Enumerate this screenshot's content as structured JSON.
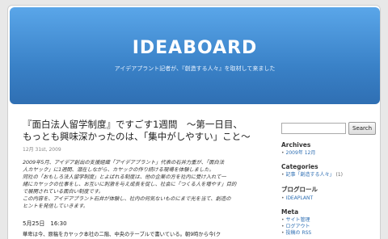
{
  "header": {
    "title": "IDEABOARD",
    "description": "アイデアプラント記者が、『創造する人々』を取材して来ました"
  },
  "post": {
    "title_line1": "『面白法人留学制度』ですごす1週間　～第一日目、",
    "title_line2": "もっとも興味深かったのは、「集中がしやすい」こと～",
    "date": "12月 31st, 2009",
    "intro_lines": [
      "2009年5月、アイデア創出の支援組織「アイデアプラント」代表の石井力重が、「面白法",
      "人カヤック」に1週間、潜在しながら、カヤックの作り続ける現場を体験しました。",
      "同社の「おもしろ法人留学制度」とよばれる制度は、他の企業の方を社内に受け入れて一",
      "緒にカヤックの仕事をし、お互いに刺激を与え成長を促し、社会に「つくる人を増やす」目的",
      "で展開されている面白い制度です。",
      "この内容を、アイデアプラント石井が体験し、社内の何気ないものにまで光を当て、創造の",
      "ヒントを発信していきます。"
    ],
    "time": "5月25日　16:30",
    "body_line": "華卑は今、原稿をカヤック本社の二階、中央のテーブルで書いている。朝9時から今(ク"
  },
  "sidebar": {
    "search_placeholder": "",
    "search_button": "Search",
    "archives_title": "Archives",
    "archives_items": [
      "2009年 12月"
    ],
    "categories_title": "Categories",
    "categories_items": [
      {
        "label": "記事「創造する人々」",
        "count": "(1)"
      }
    ],
    "blogroll_title": "ブログロール",
    "blogroll_items": [
      "IDEAPLANT"
    ],
    "meta_title": "Meta",
    "meta_items": [
      "サイト管理",
      "ログアウト",
      "投稿の RSS"
    ]
  },
  "colors": {
    "header_gradient_top": "#5aa6e9",
    "header_gradient_bottom": "#2f6fb3",
    "link": "#2f6fb3"
  }
}
